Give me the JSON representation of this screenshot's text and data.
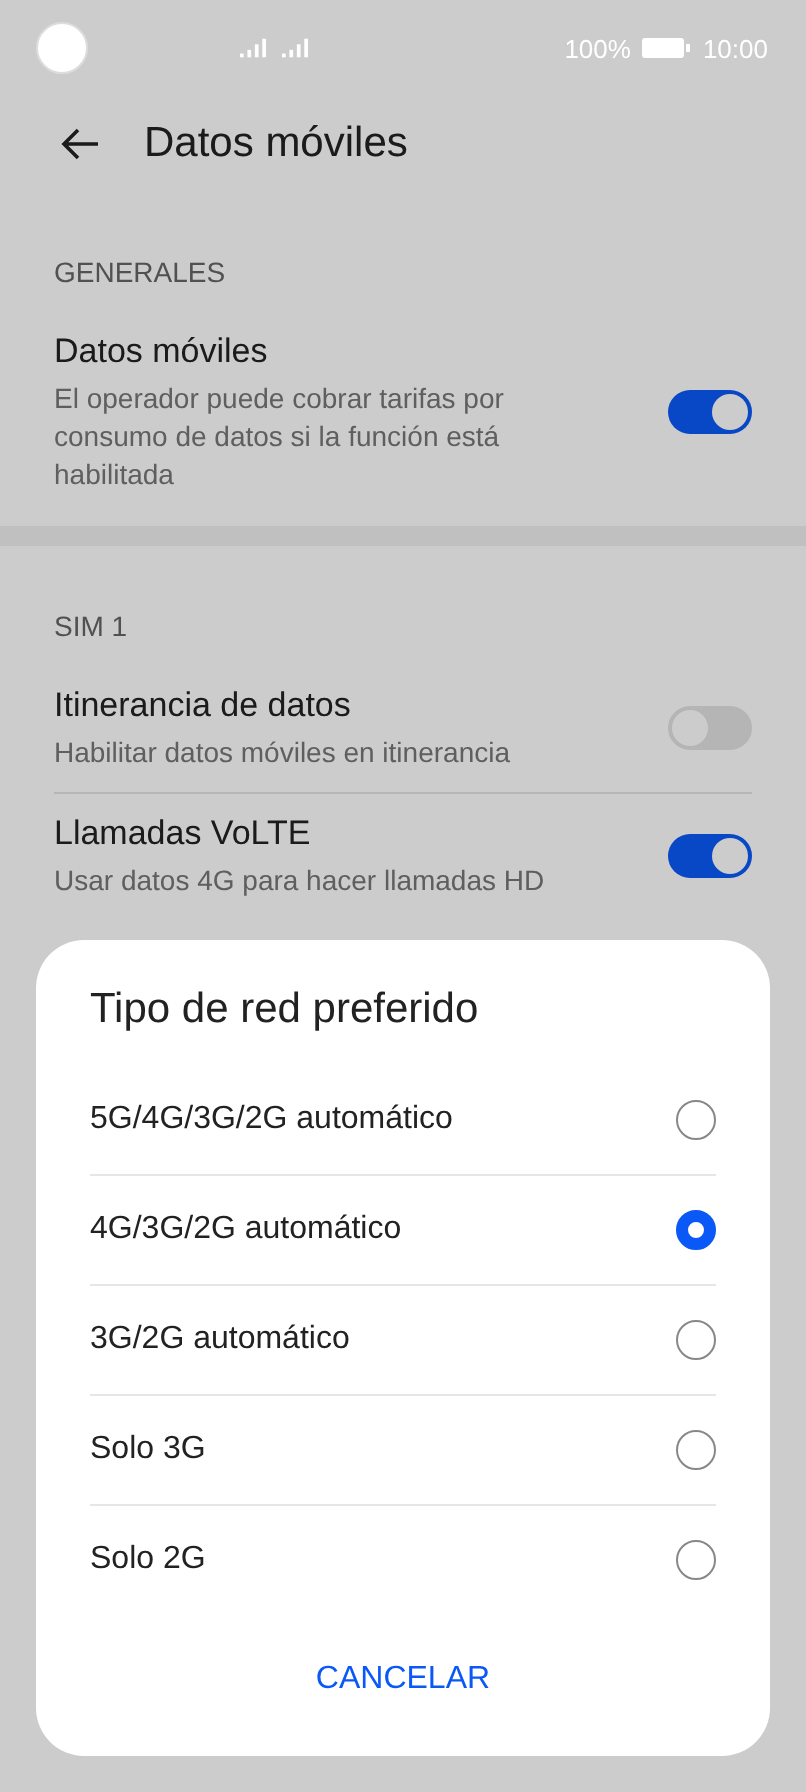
{
  "status_bar": {
    "battery": "100%",
    "time": "10:00"
  },
  "header": {
    "title": "Datos móviles"
  },
  "sections": [
    {
      "title": "GENERALES",
      "rows": [
        {
          "title": "Datos móviles",
          "subtitle": "El operador puede cobrar tarifas por consumo de datos si la función está habilitada",
          "on": true
        }
      ]
    },
    {
      "title": "SIM 1",
      "rows": [
        {
          "title": "Itinerancia de datos",
          "subtitle": "Habilitar datos móviles en itinerancia",
          "on": false
        },
        {
          "title": "Llamadas VoLTE",
          "subtitle": "Usar datos 4G para hacer llamadas HD",
          "on": true
        }
      ]
    }
  ],
  "dialog": {
    "title": "Tipo de red preferido",
    "options": [
      {
        "label": "5G/4G/3G/2G automático",
        "selected": false
      },
      {
        "label": "4G/3G/2G automático",
        "selected": true
      },
      {
        "label": "3G/2G automático",
        "selected": false
      },
      {
        "label": "Solo 3G",
        "selected": false
      },
      {
        "label": "Solo 2G",
        "selected": false
      }
    ],
    "cancel": "CANCELAR"
  }
}
